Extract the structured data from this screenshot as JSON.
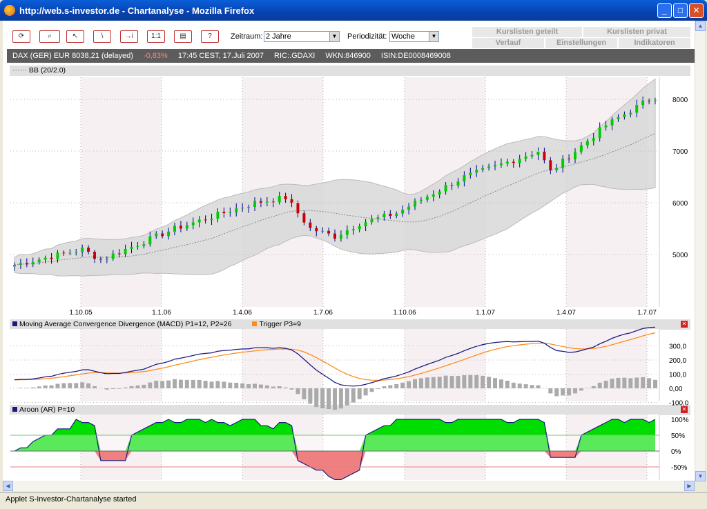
{
  "window": {
    "title": "http://web.s-investor.de - Chartanalyse - Mozilla Firefox"
  },
  "toolbar": {
    "buttons": [
      {
        "icon": "refresh-icon",
        "label": "⟳"
      },
      {
        "icon": "zoom-icon",
        "label": "⌕"
      },
      {
        "icon": "cursor-icon",
        "label": "↖"
      },
      {
        "icon": "line-draw-icon",
        "label": "\\"
      },
      {
        "icon": "info-icon",
        "label": "→i"
      },
      {
        "icon": "reset-zoom-icon",
        "label": "1:1"
      },
      {
        "icon": "print-icon",
        "label": "▤"
      },
      {
        "icon": "help-icon",
        "label": "?"
      }
    ],
    "zeitraum_label": "Zeitraum:",
    "zeitraum_value": "2 Jahre",
    "periodizitaet_label": "Periodizität:",
    "periodizitaet_value": "Woche"
  },
  "nav": {
    "top": [
      "Kurslisten geteilt",
      "Kurslisten privat"
    ],
    "bottom": [
      "Verlauf",
      "Einstellungen",
      "Indikatoren"
    ]
  },
  "info": {
    "name": "DAX (GER) EUR 8038,21 (delayed)",
    "change": "-0,83%",
    "time": "17:45 CEST, 17.Juli 2007",
    "ric": "RIC:.GDAXI",
    "wkn": "WKN:846900",
    "isin": "ISIN:DE0008469008",
    "change_color": "#ff8080"
  },
  "main_chart": {
    "header": "BB (20/2.0)",
    "y_ticks": [
      "8000",
      "7000",
      "6000",
      "5000"
    ],
    "x_ticks": [
      "1.10.05",
      "1.1.06",
      "1.4.06",
      "1.7.06",
      "1.10.06",
      "1.1.07",
      "1.4.07",
      "1.7.07"
    ]
  },
  "macd": {
    "header": "Moving Average Convergence Divergence (MACD) P1=12, P2=26",
    "trigger": "Trigger P3=9",
    "y_ticks": [
      "300,0",
      "200,0",
      "100,0",
      "0,00",
      "-100,0"
    ],
    "macd_color": "#1a1a80",
    "trigger_color": "#ff8c1a"
  },
  "aroon": {
    "header": "Aroon (AR) P=10",
    "y_ticks": [
      "100%",
      "50%",
      "0%",
      "-50%"
    ]
  },
  "status": {
    "text": "Applet S-Investor-Chartanalyse started"
  },
  "chart_data": {
    "type": "candlestick",
    "series_anchor_closes": [
      [
        0,
        4800
      ],
      [
        11,
        5100
      ],
      [
        14,
        4900
      ],
      [
        26,
        5500
      ],
      [
        39,
        6000
      ],
      [
        44,
        6100
      ],
      [
        48,
        5500
      ],
      [
        52,
        5350
      ],
      [
        56,
        5600
      ],
      [
        62,
        5800
      ],
      [
        65,
        6000
      ],
      [
        73,
        6500
      ],
      [
        78,
        6700
      ],
      [
        85,
        7000
      ],
      [
        87,
        6600
      ],
      [
        92,
        7100
      ],
      [
        96,
        7500
      ],
      [
        103,
        8000
      ],
      [
        104,
        8038
      ]
    ]
  }
}
